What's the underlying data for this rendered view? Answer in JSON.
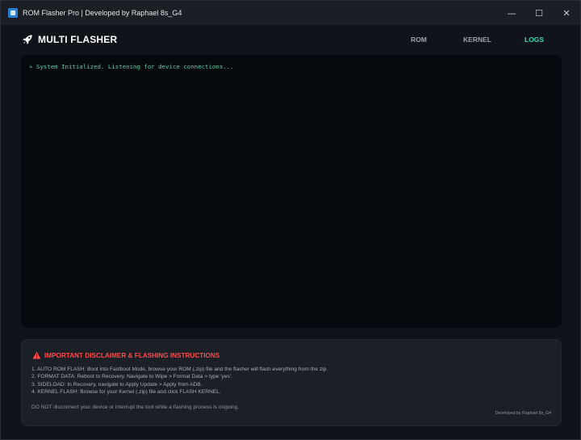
{
  "window": {
    "title": "ROM Flasher Pro | Developed by Raphael 8s_G4",
    "controls": {
      "minimize": "—",
      "maximize": "☐",
      "close": "✕"
    }
  },
  "header": {
    "brand": "MULTI FLASHER",
    "brand_icon": "rocket-icon",
    "nav": [
      {
        "label": "ROM",
        "active": false
      },
      {
        "label": "KERNEL",
        "active": false
      },
      {
        "label": "LOGS",
        "active": true
      }
    ],
    "accent_color": "#3dd6b8"
  },
  "console": {
    "lines": [
      "» System Initialized. Listening for device connections..."
    ]
  },
  "disclaimer": {
    "title": "IMPORTANT DISCLAIMER & FLASHING INSTRUCTIONS",
    "title_color": "#ff4a4a",
    "instructions": [
      "1. AUTO ROM FLASH: Boot into Fastboot Mode, browse your ROM (.zip) file and the flasher will flash everything from the zip.",
      "2. FORMAT DATA: Reboot to Recovery. Navigate to Wipe > Format Data > type 'yes'.",
      "3. SIDELOAD: In Recovery, navigate to Apply Update > Apply from ADB.",
      "4. KERNEL FLASH: Browse for your Kernel (.zip) file and click FLASH KERNEL."
    ],
    "warning": "DO NOT disconnect your device or interrupt the tool while a flashing process is ongoing.",
    "credit": "Developed by Raphael 8s_G4"
  }
}
